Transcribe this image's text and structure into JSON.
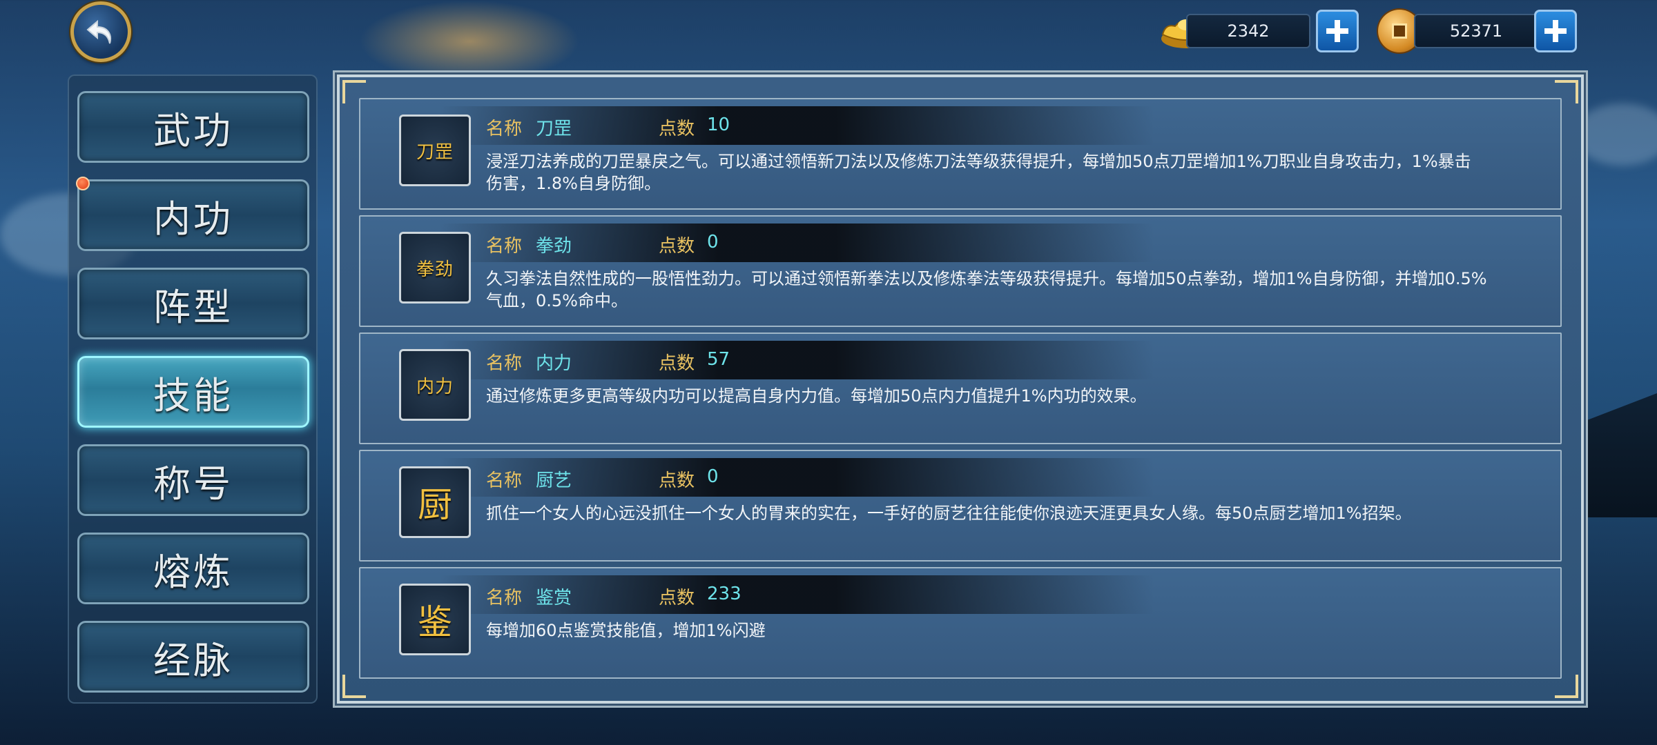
{
  "currency": {
    "ingot": {
      "amount": "2342"
    },
    "coin": {
      "amount": "52371"
    }
  },
  "sidebar": {
    "items": [
      {
        "label": "武功"
      },
      {
        "label": "内功"
      },
      {
        "label": "阵型"
      },
      {
        "label": "技能"
      },
      {
        "label": "称号"
      },
      {
        "label": "熔炼"
      },
      {
        "label": "经脉"
      }
    ],
    "active": "技能"
  },
  "skills": {
    "name_label": "名称",
    "points_label": "点数",
    "items": [
      {
        "icon_text": "刀罡",
        "name": "刀罡",
        "points": "10",
        "desc": "浸淫刀法养成的刀罡暴戾之气。可以通过领悟新刀法以及修炼刀法等级获得提升，每增加50点刀罡增加1%刀职业自身攻击力，1%暴击伤害，1.8%自身防御。"
      },
      {
        "icon_text": "拳劲",
        "name": "拳劲",
        "points": "0",
        "desc": "久习拳法自然性成的一股悟性劲力。可以通过领悟新拳法以及修炼拳法等级获得提升。每增加50点拳劲，增加1%自身防御，并增加0.5%气血，0.5%命中。"
      },
      {
        "icon_text": "内力",
        "name": "内力",
        "points": "57",
        "desc": "通过修炼更多更高等级内功可以提高自身内力值。每增加50点内力值提升1%内功的效果。"
      },
      {
        "icon_text": "厨",
        "name": "厨艺",
        "points": "0",
        "desc": "抓住一个女人的心远没抓住一个女人的胃来的实在，一手好的厨艺往往能使你浪迹天涯更具女人缘。每50点厨艺增加1%招架。"
      },
      {
        "icon_text": "鉴",
        "name": "鉴赏",
        "points": "233",
        "desc": "每增加60点鉴赏技能值，增加1%闪避"
      }
    ]
  }
}
